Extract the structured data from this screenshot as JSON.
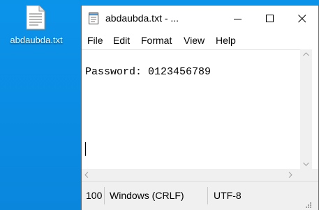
{
  "desktop": {
    "icon_label": "abdaubda.txt",
    "background_color": "#0a8ce6"
  },
  "window": {
    "title": "abdaubda.txt - ...",
    "controls": {
      "minimize_icon": "minimize-icon",
      "maximize_icon": "maximize-icon",
      "close_icon": "close-icon"
    }
  },
  "menu": {
    "items": [
      "File",
      "Edit",
      "Format",
      "View",
      "Help"
    ]
  },
  "editor": {
    "content": "Password: 0123456789"
  },
  "status": {
    "zoom": "100",
    "line_ending": "Windows (CRLF)",
    "encoding": "UTF-8"
  }
}
